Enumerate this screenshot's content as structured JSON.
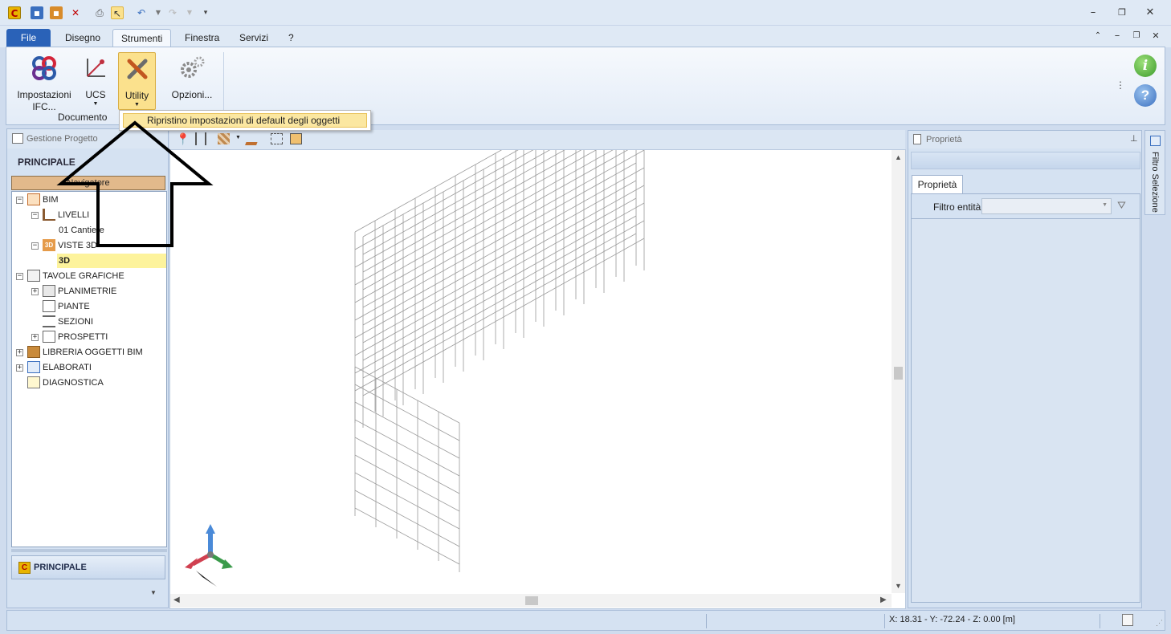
{
  "ribbon_tabs": {
    "file": "File",
    "disegno": "Disegno",
    "strumenti": "Strumenti",
    "finestra": "Finestra",
    "servizi": "Servizi",
    "help": "?"
  },
  "ribbon": {
    "impostazioni_ifc_line1": "Impostazioni",
    "impostazioni_ifc_line2": "IFC...",
    "ucs": "UCS",
    "utility": "Utility",
    "opzioni": "Opzioni...",
    "group_documento": "Documento"
  },
  "dropdown": {
    "item": "Ripristino impostazioni di default degli oggetti"
  },
  "left_panel": {
    "title": "Gestione Progetto",
    "section": "PRINCIPALE",
    "navigator": "Navigatore",
    "tree": {
      "bim": "BIM",
      "livelli": "LIVELLI",
      "cantiere": "01 Cantiere",
      "viste3d": "VISTE 3D",
      "v3d": "3D",
      "tavole": "TAVOLE GRAFICHE",
      "planimetrie": "PLANIMETRIE",
      "piante": "PIANTE",
      "sezioni": "SEZIONI",
      "prospetti": "PROSPETTI",
      "libreria": "LIBRERIA OGGETTI BIM",
      "elaborati": "ELABORATI",
      "diagnostica": "DIAGNOSTICA"
    },
    "bottom_button": "PRINCIPALE"
  },
  "right_panel": {
    "title": "Proprietà",
    "tab": "Proprietà",
    "filter_label": "Filtro entità",
    "side_tab": "Filtro Selezione"
  },
  "status": {
    "coords": "X: 18.31 - Y: -72.24 - Z: 0.00 [m]"
  },
  "colors": {
    "accent_file_tab": "#2a62b8",
    "selection_yellow": "#fdf39c",
    "navigator_bar": "#e2b98b",
    "dropdown_highlight": "#fbe7a1"
  }
}
